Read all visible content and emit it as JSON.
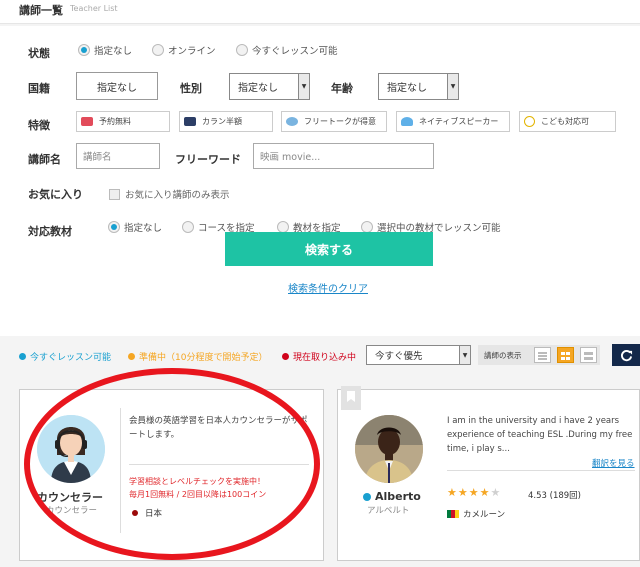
{
  "header": {
    "title": "講師一覧",
    "subtitle": "Teacher List"
  },
  "filters": {
    "status": {
      "label": "状態",
      "options": [
        "指定なし",
        "オンライン",
        "今すぐレッスン可能"
      ],
      "selected": 0
    },
    "nationality": {
      "label": "国籍",
      "value": "指定なし"
    },
    "gender": {
      "label": "性別",
      "value": "指定なし"
    },
    "age": {
      "label": "年齢",
      "value": "指定なし"
    },
    "features": {
      "label": "特徴",
      "chips": [
        "予約無料",
        "カラン半額",
        "フリートークが得意",
        "ネイティブスピーカー",
        "こども対応可"
      ]
    },
    "teacher_name": {
      "label": "講師名",
      "placeholder": "講師名"
    },
    "freeword": {
      "label": "フリーワード",
      "placeholder": "映画 movie..."
    },
    "favorites": {
      "label": "お気に入り",
      "checkbox_label": "お気に入り講師のみ表示"
    },
    "materials": {
      "label": "対応教材",
      "options": [
        "指定なし",
        "コースを指定",
        "教材を指定",
        "選択中の教材でレッスン可能"
      ],
      "selected": 0
    }
  },
  "actions": {
    "search_label": "検索する",
    "clear_label": "検索条件のクリア"
  },
  "status_legend": [
    {
      "label": "今すぐレッスン可能",
      "color": "#19a0d0"
    },
    {
      "label": "準備中（10分程度で開始予定）",
      "color": "#f5a623"
    },
    {
      "label": "現在取り込み中",
      "color": "#d0021b"
    }
  ],
  "sort": {
    "value": "今すぐ優先"
  },
  "view": {
    "label": "講師の表示"
  },
  "teachers": [
    {
      "name": "カウンセラー",
      "kana": "カウンセラー",
      "description": "会員様の英語学習を日本人カウンセラーがサポートします。",
      "promo": [
        "学習相談とレベルチェックを実施中！",
        "毎月1回無料 / 2回目以降は100コイン"
      ],
      "country": "日本"
    },
    {
      "name": "Alberto",
      "kana": "アルベルト",
      "description": "I am in the university and i have 2 years experience of teaching ESL .During my free time, i play s...",
      "more_label": "翻訳を見る",
      "rating": "4.53 (189回)",
      "stars": 4.5,
      "country": "カメルーン"
    }
  ],
  "colors": {
    "accent": "#1ec3a4",
    "link": "#1a86c8",
    "highlight_ring": "#e8161e"
  }
}
